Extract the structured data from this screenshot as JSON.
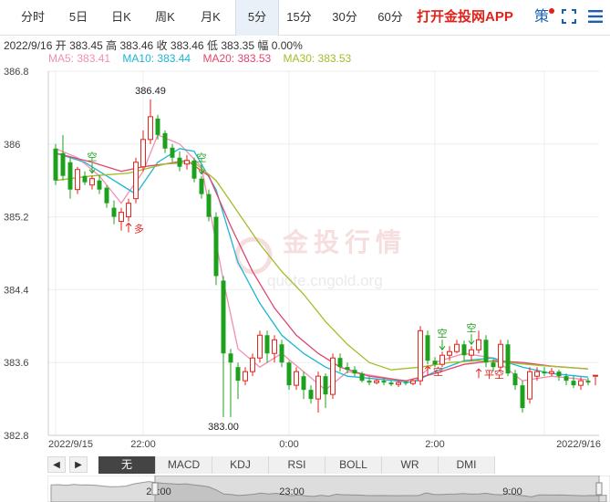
{
  "tabs": [
    {
      "label": "分时",
      "active": false
    },
    {
      "label": "5日",
      "active": false
    },
    {
      "label": "日K",
      "active": false
    },
    {
      "label": "周K",
      "active": false
    },
    {
      "label": "月K",
      "active": false
    },
    {
      "label": "5分",
      "active": true
    },
    {
      "label": "15分",
      "active": false
    },
    {
      "label": "30分",
      "active": false
    },
    {
      "label": "60分",
      "active": false
    }
  ],
  "app_link": "打开金投网APP",
  "strategy_label": "策",
  "info": {
    "date": "2022/9/16",
    "open_label": "开",
    "open": "383.45",
    "high_label": "高",
    "high": "383.46",
    "close_label": "收",
    "close": "383.46",
    "low_label": "低",
    "low": "383.35",
    "amp_label": "幅",
    "amp": "0.00%"
  },
  "ma_legend": [
    {
      "label": "MA5: 383.41",
      "color": "#f28fb0"
    },
    {
      "label": "MA10: 383.44",
      "color": "#1cb6d4"
    },
    {
      "label": "MA20: 383.53",
      "color": "#e0466e"
    },
    {
      "label": "MA30: 383.53",
      "color": "#a3bd2a"
    }
  ],
  "watermark": {
    "name": "金投行情",
    "url": "quote.cngold.org"
  },
  "indicators": [
    {
      "label": "无",
      "active": true
    },
    {
      "label": "MACD",
      "active": false
    },
    {
      "label": "KDJ",
      "active": false
    },
    {
      "label": "RSI",
      "active": false
    },
    {
      "label": "BOLL",
      "active": false
    },
    {
      "label": "WR",
      "active": false
    },
    {
      "label": "DMI",
      "active": false
    }
  ],
  "nav_prev": "◀",
  "nav_next": "▶",
  "navigator_labels": [
    "22:00",
    "23:00",
    "9:00"
  ],
  "chart_data": {
    "type": "candlestick",
    "ylim": [
      382.8,
      386.8
    ],
    "y_ticks": [
      "386.8",
      "386",
      "385.2",
      "384.4",
      "383.6",
      "382.8"
    ],
    "x_ticks": [
      {
        "label": "2022/9/15",
        "pos": 0
      },
      {
        "label": "22:00",
        "pos": 12
      },
      {
        "label": "0:00",
        "pos": 32
      },
      {
        "label": "2:00",
        "pos": 52
      },
      {
        "label": "2022/9/16",
        "pos": 67
      }
    ],
    "up_color": "#e0221a",
    "down_color": "#1ca11c",
    "candles": [
      [
        385.95,
        385.6,
        386.0,
        385.55
      ],
      [
        385.9,
        385.65,
        386.1,
        385.6
      ],
      [
        385.8,
        385.5,
        385.85,
        385.4
      ],
      [
        385.5,
        385.72,
        385.75,
        385.45
      ],
      [
        385.65,
        385.58,
        385.7,
        385.55
      ],
      [
        385.55,
        385.62,
        385.65,
        385.5
      ],
      [
        385.6,
        385.5,
        385.66,
        385.45
      ],
      [
        385.52,
        385.35,
        385.55,
        385.3
      ],
      [
        385.3,
        385.2,
        385.38,
        385.12
      ],
      [
        385.15,
        385.25,
        385.3,
        385.05
      ],
      [
        385.2,
        385.35,
        385.4,
        385.15
      ],
      [
        385.4,
        385.8,
        385.85,
        385.35
      ],
      [
        385.75,
        386.05,
        386.15,
        385.7
      ],
      [
        386.05,
        386.3,
        386.49,
        386.0
      ],
      [
        386.28,
        386.1,
        386.32,
        386.05
      ],
      [
        386.12,
        385.95,
        386.15,
        385.9
      ],
      [
        385.96,
        385.85,
        386.0,
        385.8
      ],
      [
        385.85,
        385.75,
        385.92,
        385.7
      ],
      [
        385.78,
        385.82,
        385.88,
        385.72
      ],
      [
        385.82,
        385.62,
        385.85,
        385.58
      ],
      [
        385.62,
        385.45,
        385.65,
        385.4
      ],
      [
        385.45,
        385.2,
        385.5,
        385.15
      ],
      [
        385.2,
        384.55,
        385.25,
        384.45
      ],
      [
        384.5,
        383.7,
        384.55,
        383.0
      ],
      [
        383.7,
        383.6,
        383.75,
        383.0
      ],
      [
        383.55,
        383.4,
        383.6,
        383.2
      ],
      [
        383.4,
        383.5,
        383.55,
        383.35
      ],
      [
        383.5,
        383.65,
        383.7,
        383.45
      ],
      [
        383.65,
        383.9,
        383.95,
        383.6
      ],
      [
        383.9,
        383.7,
        383.95,
        383.6
      ],
      [
        383.7,
        383.85,
        383.9,
        383.6
      ],
      [
        383.8,
        383.6,
        383.85,
        383.55
      ],
      [
        383.6,
        383.35,
        383.62,
        383.3
      ],
      [
        383.35,
        383.5,
        383.55,
        383.3
      ],
      [
        383.45,
        383.3,
        383.5,
        383.2
      ],
      [
        383.3,
        383.2,
        383.35,
        383.15
      ],
      [
        383.2,
        383.45,
        383.5,
        383.05
      ],
      [
        383.45,
        383.25,
        383.48,
        383.1
      ],
      [
        383.25,
        383.65,
        383.7,
        383.2
      ],
      [
        383.65,
        383.55,
        383.7,
        383.5
      ],
      [
        383.55,
        383.52,
        383.6,
        383.48
      ],
      [
        383.52,
        383.48,
        383.56,
        383.45
      ],
      [
        383.48,
        383.4,
        383.5,
        383.38
      ],
      [
        383.4,
        383.38,
        383.44,
        383.35
      ],
      [
        383.38,
        383.4,
        383.42,
        383.36
      ],
      [
        383.4,
        383.38,
        383.43,
        383.35
      ],
      [
        383.38,
        383.36,
        383.4,
        383.34
      ],
      [
        383.36,
        383.38,
        383.4,
        383.33
      ],
      [
        383.38,
        383.37,
        383.4,
        383.35
      ],
      [
        383.37,
        383.4,
        383.42,
        383.35
      ],
      [
        383.4,
        383.95,
        384.0,
        383.35
      ],
      [
        383.9,
        383.62,
        383.95,
        383.58
      ],
      [
        383.62,
        383.58,
        383.66,
        383.55
      ],
      [
        383.58,
        383.68,
        383.72,
        383.55
      ],
      [
        383.68,
        383.72,
        383.78,
        383.62
      ],
      [
        383.72,
        383.8,
        383.85,
        383.7
      ],
      [
        383.8,
        383.68,
        383.84,
        383.62
      ],
      [
        383.68,
        383.74,
        383.78,
        383.62
      ],
      [
        383.74,
        383.85,
        383.95,
        383.7
      ],
      [
        383.85,
        383.6,
        383.9,
        383.55
      ],
      [
        383.6,
        383.55,
        383.64,
        383.5
      ],
      [
        383.55,
        383.8,
        383.85,
        383.5
      ],
      [
        383.8,
        383.48,
        383.85,
        383.45
      ],
      [
        383.48,
        383.35,
        383.52,
        383.3
      ],
      [
        383.35,
        383.1,
        383.4,
        383.05
      ],
      [
        383.2,
        383.5,
        383.55,
        383.15
      ],
      [
        383.45,
        383.5,
        383.55,
        383.4
      ],
      [
        383.5,
        383.48,
        383.55,
        383.45
      ],
      [
        383.48,
        383.5,
        383.54,
        383.45
      ],
      [
        383.5,
        383.45,
        383.52,
        383.4
      ],
      [
        383.45,
        383.4,
        383.48,
        383.35
      ],
      [
        383.4,
        383.35,
        383.45,
        383.32
      ],
      [
        383.35,
        383.4,
        383.44,
        383.3
      ],
      [
        383.4,
        383.38,
        383.43,
        383.35
      ],
      [
        383.45,
        383.46,
        383.46,
        383.35
      ]
    ],
    "ma": [
      {
        "name": "MA5",
        "color": "#f28fb0",
        "points": [
          [
            0,
            385.95
          ],
          [
            3,
            385.85
          ],
          [
            6,
            385.65
          ],
          [
            9,
            385.35
          ],
          [
            12,
            385.7
          ],
          [
            14,
            386.1
          ],
          [
            17,
            386.0
          ],
          [
            20,
            385.75
          ],
          [
            23,
            384.5
          ],
          [
            25,
            383.75
          ],
          [
            28,
            383.55
          ],
          [
            31,
            383.7
          ],
          [
            34,
            383.5
          ],
          [
            37,
            383.3
          ],
          [
            40,
            383.5
          ],
          [
            44,
            383.45
          ],
          [
            49,
            383.38
          ],
          [
            52,
            383.6
          ],
          [
            56,
            383.7
          ],
          [
            60,
            383.65
          ],
          [
            64,
            383.4
          ],
          [
            68,
            383.45
          ],
          [
            73,
            383.41
          ]
        ]
      },
      {
        "name": "MA10",
        "color": "#1cb6d4",
        "points": [
          [
            0,
            385.9
          ],
          [
            4,
            385.8
          ],
          [
            8,
            385.6
          ],
          [
            11,
            385.45
          ],
          [
            14,
            385.8
          ],
          [
            17,
            385.95
          ],
          [
            19,
            385.92
          ],
          [
            22,
            385.5
          ],
          [
            25,
            384.7
          ],
          [
            28,
            384.25
          ],
          [
            31,
            383.9
          ],
          [
            34,
            383.7
          ],
          [
            37,
            383.55
          ],
          [
            40,
            383.45
          ],
          [
            44,
            383.42
          ],
          [
            49,
            383.38
          ],
          [
            52,
            383.5
          ],
          [
            56,
            383.62
          ],
          [
            60,
            383.65
          ],
          [
            64,
            383.55
          ],
          [
            68,
            383.48
          ],
          [
            73,
            383.44
          ]
        ]
      },
      {
        "name": "MA20",
        "color": "#e0466e",
        "points": [
          [
            0,
            385.9
          ],
          [
            5,
            385.8
          ],
          [
            9,
            385.7
          ],
          [
            12,
            385.75
          ],
          [
            15,
            385.78
          ],
          [
            18,
            385.82
          ],
          [
            21,
            385.65
          ],
          [
            24,
            385.1
          ],
          [
            27,
            384.6
          ],
          [
            30,
            384.2
          ],
          [
            33,
            383.9
          ],
          [
            36,
            383.7
          ],
          [
            39,
            383.55
          ],
          [
            43,
            383.45
          ],
          [
            48,
            383.4
          ],
          [
            52,
            383.48
          ],
          [
            56,
            383.58
          ],
          [
            60,
            383.62
          ],
          [
            64,
            383.6
          ],
          [
            68,
            383.56
          ],
          [
            73,
            383.53
          ]
        ]
      },
      {
        "name": "MA30",
        "color": "#a3bd2a",
        "points": [
          [
            0,
            385.6
          ],
          [
            5,
            385.65
          ],
          [
            10,
            385.68
          ],
          [
            15,
            385.78
          ],
          [
            19,
            385.8
          ],
          [
            22,
            385.6
          ],
          [
            25,
            385.25
          ],
          [
            28,
            384.9
          ],
          [
            31,
            384.6
          ],
          [
            34,
            384.35
          ],
          [
            37,
            384.05
          ],
          [
            40,
            383.8
          ],
          [
            43,
            383.6
          ],
          [
            46,
            383.52
          ],
          [
            50,
            383.55
          ],
          [
            54,
            383.6
          ],
          [
            58,
            383.62
          ],
          [
            62,
            383.6
          ],
          [
            66,
            383.57
          ],
          [
            73,
            383.53
          ]
        ]
      }
    ],
    "annotations": [
      {
        "type": "value",
        "text": "386.49",
        "idx": 13,
        "price": 386.49,
        "pos": "above"
      },
      {
        "type": "value",
        "text": "383.00",
        "idx": 23,
        "price": 383.0,
        "pos": "below"
      },
      {
        "type": "signal",
        "text": "空",
        "idx": 5,
        "price": 385.66,
        "pos": "above",
        "color": "#1ca11c"
      },
      {
        "type": "signal",
        "text": "多",
        "idx": 10,
        "price": 385.15,
        "pos": "below",
        "color": "#e0221a"
      },
      {
        "type": "signal",
        "text": "空",
        "idx": 20,
        "price": 385.65,
        "pos": "above",
        "color": "#1ca11c"
      },
      {
        "type": "signal",
        "text": "空",
        "idx": 53,
        "price": 383.72,
        "pos": "above",
        "color": "#1ca11c"
      },
      {
        "type": "signal",
        "text": "空",
        "idx": 57,
        "price": 383.78,
        "pos": "above",
        "color": "#1ca11c"
      },
      {
        "type": "signal",
        "text": "空",
        "idx": 51,
        "price": 383.58,
        "pos": "below",
        "color": "#e0221a"
      },
      {
        "type": "signal",
        "text": "平空",
        "idx": 58,
        "price": 383.55,
        "pos": "below",
        "color": "#e0221a"
      }
    ]
  }
}
